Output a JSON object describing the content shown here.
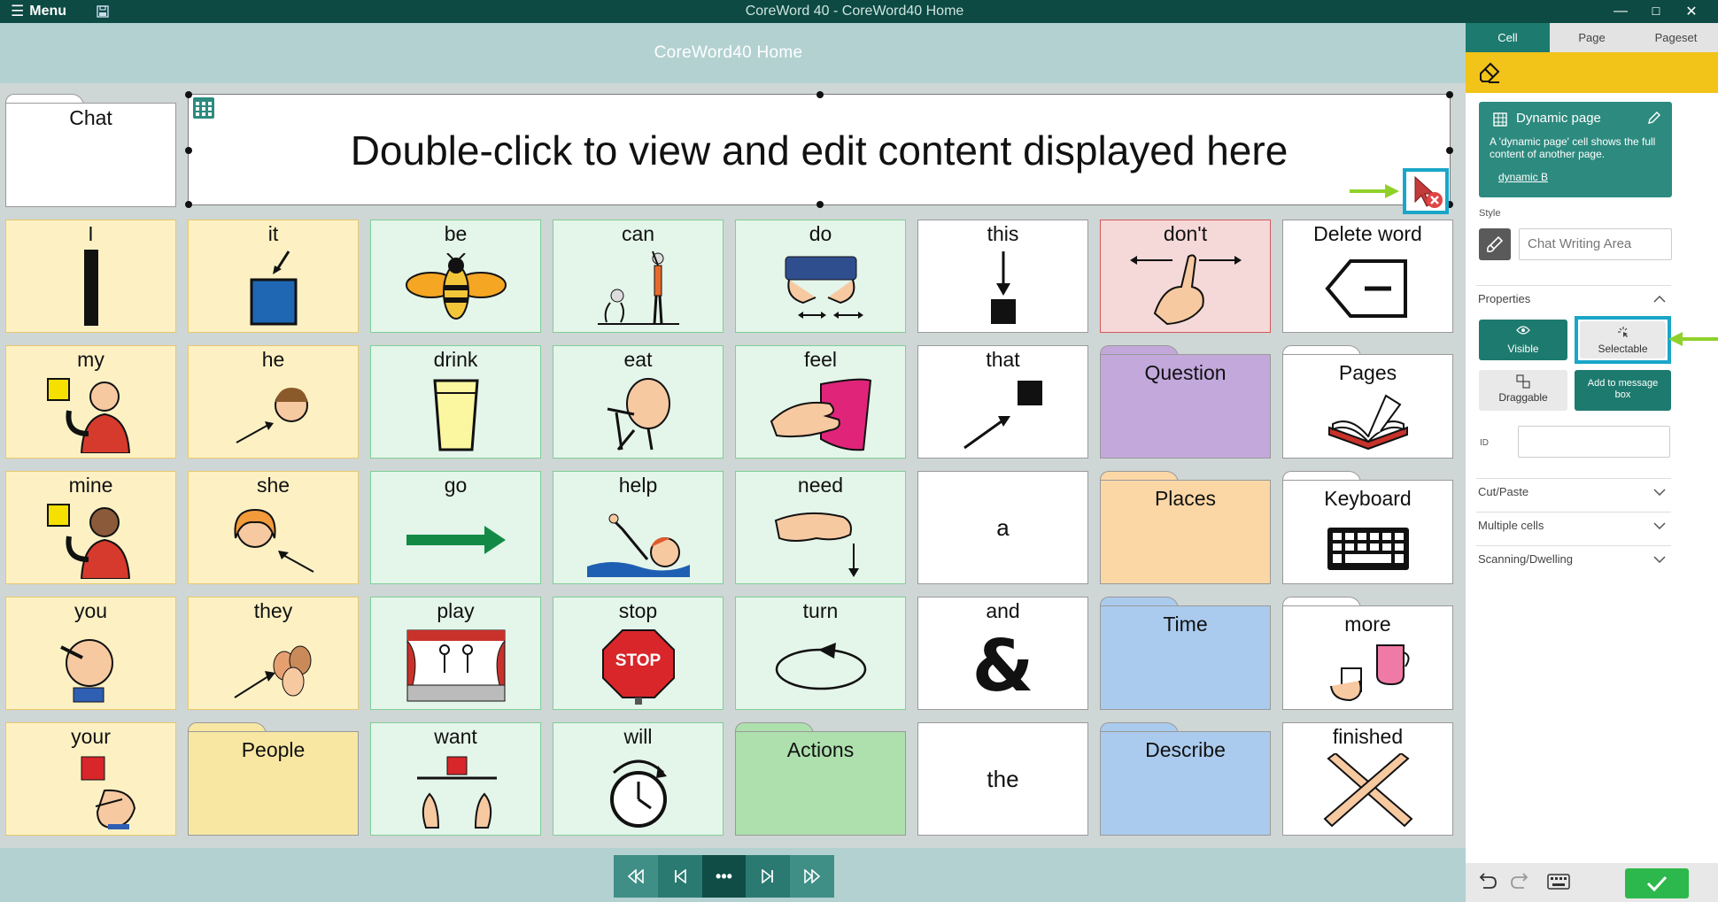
{
  "window": {
    "menu_label": "Menu",
    "title": "CoreWord 40 - CoreWord40 Home",
    "minimize": "—",
    "maximize": "☐",
    "close": "✕"
  },
  "page": {
    "title": "CoreWord40 Home"
  },
  "message_bar": {
    "text": "Double-click to view and edit content displayed here"
  },
  "chat_cell": {
    "label": "Chat"
  },
  "grid": {
    "rows": [
      [
        "I",
        "it",
        "be",
        "can",
        "do",
        "this",
        "don't",
        "Delete word"
      ],
      [
        "my",
        "he",
        "drink",
        "eat",
        "feel",
        "that",
        "Question",
        "Pages"
      ],
      [
        "mine",
        "she",
        "go",
        "help",
        "need",
        "a",
        "Places",
        "Keyboard"
      ],
      [
        "you",
        "they",
        "play",
        "stop",
        "turn",
        "and",
        "Time",
        "more"
      ],
      [
        "your",
        "People",
        "want",
        "will",
        "Actions",
        "the",
        "Describe",
        "finished"
      ]
    ],
    "stop_sign_text": "STOP"
  },
  "colors": {
    "title_bar": "#0c4a43",
    "header_band": "#b3d1d1",
    "pronoun": "#fdf1c4",
    "verb": "#e4f5ea",
    "negation": "#f5d8d8",
    "folder_purple": "#c3a8dc",
    "folder_orange": "#fcd7a6",
    "folder_blue": "#aacbed",
    "folder_green": "#aee0ae",
    "folder_yellow": "#f8e7a2",
    "accent_teal": "#1d7a6e",
    "accent_yellow": "#f2c318",
    "highlight_cyan": "#1aa6c8",
    "arrow_green": "#8fd12a"
  },
  "panel": {
    "tabs": [
      "Cell",
      "Page",
      "Pageset"
    ],
    "dynamic_page": {
      "title": "Dynamic page",
      "description": "A 'dynamic page' cell shows the full content of another page.",
      "link": "dynamic B"
    },
    "style_label": "Style",
    "style_value": "Chat Writing Area",
    "properties_label": "Properties",
    "buttons": {
      "visible": "Visible",
      "selectable": "Selectable",
      "draggable": "Draggable",
      "add_to_message_box": "Add to message box"
    },
    "id_label": "ID",
    "id_value": "",
    "sections": [
      "Cut/Paste",
      "Multiple cells",
      "Scanning/Dwelling"
    ]
  },
  "icons": {
    "menu": "hamburger-icon",
    "save": "save-icon",
    "grid": "grid-icon",
    "eraser": "eraser-icon",
    "edit": "pencil-icon",
    "eye": "eye-icon",
    "undo": "undo-icon",
    "redo": "redo-icon",
    "keyboard": "keyboard-icon",
    "confirm": "check-icon"
  }
}
